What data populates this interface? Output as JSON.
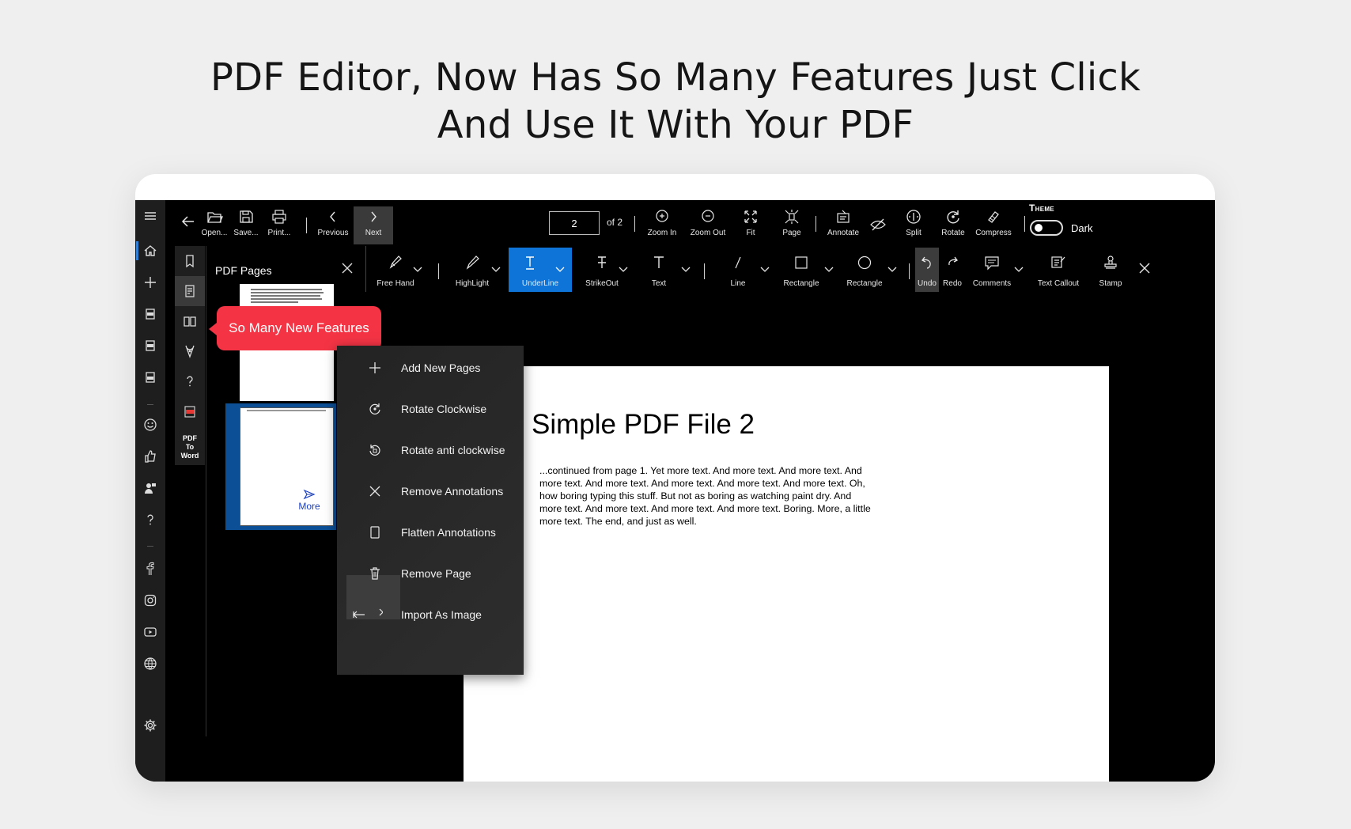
{
  "headline": {
    "line1": "PDF Editor, Now Has So Many Features Just Click",
    "line2": "And Use It With Your PDF"
  },
  "toolbar": {
    "open": "Open...",
    "save": "Save...",
    "print": "Print...",
    "previous": "Previous",
    "next": "Next",
    "page_value": "2",
    "page_total": "of 2",
    "zoom_in": "Zoom In",
    "zoom_out": "Zoom Out",
    "fit": "Fit",
    "page": "Page",
    "annotate": "Annotate",
    "split": "Split",
    "rotate": "Rotate",
    "compress": "Compress",
    "theme_title": "Theme",
    "theme_value": "Dark"
  },
  "panel": {
    "title": "PDF Pages",
    "more": "More",
    "pdf_to_word": [
      "PDF",
      "To",
      "Word"
    ]
  },
  "tooltip": "So Many New Features",
  "annotate_bar": {
    "free_hand": "Free Hand",
    "highlight": "HighLight",
    "underline": "UnderLine",
    "strikeout": "StrikeOut",
    "text": "Text",
    "line": "Line",
    "rectangle": "Rectangle",
    "ellipse": "Rectangle",
    "undo": "Undo",
    "redo": "Redo",
    "comments": "Comments",
    "text_callout": "Text Callout",
    "stamp": "Stamp"
  },
  "menu": [
    {
      "label": "Add New Pages",
      "icon": "plus-icon"
    },
    {
      "label": "Rotate Clockwise",
      "icon": "rotate-clockwise-icon"
    },
    {
      "label": "Rotate anti clockwise",
      "icon": "rotate-anticlockwise-icon"
    },
    {
      "label": "Remove Annotations",
      "icon": "close-icon"
    },
    {
      "label": "Flatten Annotations",
      "icon": "page-icon"
    },
    {
      "label": "Remove Page",
      "icon": "trash-icon"
    },
    {
      "label": "Import As Image",
      "icon": "import-icon"
    }
  ],
  "document": {
    "title": "Simple PDF File 2",
    "body": "...continued from page 1. Yet more text. And more text. And more text. And more text. And more text. And more text. And more text. And more text. Oh, how boring typing this stuff. But not as boring as watching paint dry. And more text. And more text. And more text. And more text. Boring.  More, a little more text. The end, and just as well."
  },
  "colors": {
    "accent_blue": "#0e74d8",
    "tooltip_red": "#f43445",
    "selected_thumb": "#0c4f96"
  }
}
